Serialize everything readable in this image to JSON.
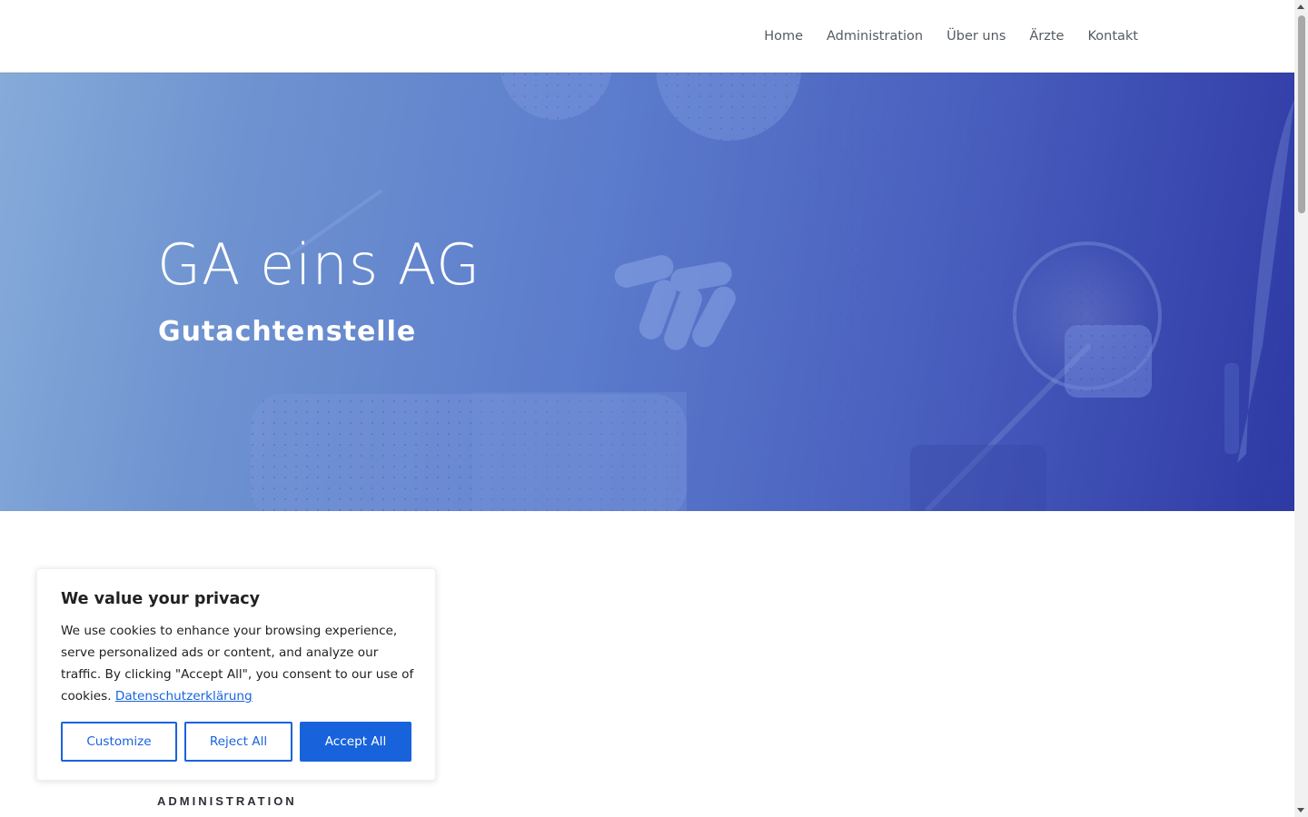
{
  "nav": {
    "items": [
      {
        "label": "Home"
      },
      {
        "label": "Administration"
      },
      {
        "label": "Über uns"
      },
      {
        "label": "Ärzte"
      },
      {
        "label": "Kontakt"
      }
    ]
  },
  "hero": {
    "title": "GA eins AG",
    "subtitle": "Gutachtenstelle"
  },
  "section": {
    "label": "ADMINISTRATION"
  },
  "cookie_banner": {
    "title": "We value your privacy",
    "text": "We use cookies to enhance your browsing experience, serve personalized ads or content, and analyze our traffic. By clicking \"Accept All\", you consent to our use of cookies.",
    "link_label": "Datenschutzerklärung",
    "buttons": {
      "customize": "Customize",
      "reject": "Reject All",
      "accept": "Accept All"
    }
  },
  "colors": {
    "accent": "#1863dc",
    "hero_gradient_start": "#86abd9",
    "hero_gradient_end": "#2e39a4",
    "nav_text": "#555b62"
  }
}
